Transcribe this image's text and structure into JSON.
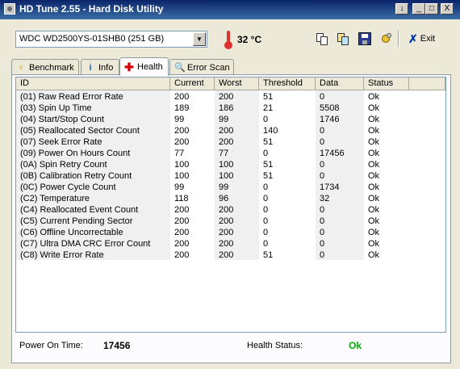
{
  "window": {
    "title": "HD Tune 2.55 - Hard Disk Utility",
    "controls": [
      "↓",
      "_",
      "□",
      "X"
    ]
  },
  "toolbar": {
    "drive": "WDC WD2500YS-01SHB0 (251 GB)",
    "temperature": "32 °C",
    "exit_label": "Exit",
    "icons": [
      "copy-text-icon",
      "copy-screenshot-icon",
      "save-icon",
      "options-icon",
      "exit-icon"
    ]
  },
  "tabs": [
    {
      "label": "Benchmark",
      "icon": "bulb-icon"
    },
    {
      "label": "Info",
      "icon": "info-icon"
    },
    {
      "label": "Health",
      "icon": "health-cross-icon"
    },
    {
      "label": "Error Scan",
      "icon": "magnifier-icon"
    }
  ],
  "health": {
    "columns": [
      "ID",
      "Current",
      "Worst",
      "Threshold",
      "Data",
      "Status"
    ],
    "rows": [
      [
        "(01) Raw Read Error Rate",
        "200",
        "200",
        "51",
        "0",
        "Ok"
      ],
      [
        "(03) Spin Up Time",
        "189",
        "186",
        "21",
        "5508",
        "Ok"
      ],
      [
        "(04) Start/Stop Count",
        "99",
        "99",
        "0",
        "1746",
        "Ok"
      ],
      [
        "(05) Reallocated Sector Count",
        "200",
        "200",
        "140",
        "0",
        "Ok"
      ],
      [
        "(07) Seek Error Rate",
        "200",
        "200",
        "51",
        "0",
        "Ok"
      ],
      [
        "(09) Power On Hours Count",
        "77",
        "77",
        "0",
        "17456",
        "Ok"
      ],
      [
        "(0A) Spin Retry Count",
        "100",
        "100",
        "51",
        "0",
        "Ok"
      ],
      [
        "(0B) Calibration Retry Count",
        "100",
        "100",
        "51",
        "0",
        "Ok"
      ],
      [
        "(0C) Power Cycle Count",
        "99",
        "99",
        "0",
        "1734",
        "Ok"
      ],
      [
        "(C2) Temperature",
        "118",
        "96",
        "0",
        "32",
        "Ok"
      ],
      [
        "(C4) Reallocated Event Count",
        "200",
        "200",
        "0",
        "0",
        "Ok"
      ],
      [
        "(C5) Current Pending Sector",
        "200",
        "200",
        "0",
        "0",
        "Ok"
      ],
      [
        "(C6) Offline Uncorrectable",
        "200",
        "200",
        "0",
        "0",
        "Ok"
      ],
      [
        "(C7) Ultra DMA CRC Error Count",
        "200",
        "200",
        "0",
        "0",
        "Ok"
      ],
      [
        "(C8) Write Error Rate",
        "200",
        "200",
        "51",
        "0",
        "Ok"
      ]
    ]
  },
  "footer": {
    "power_on_label": "Power On Time:",
    "power_on_value": "17456",
    "health_label": "Health Status:",
    "health_value": "Ok",
    "health_color": "#00b000"
  }
}
